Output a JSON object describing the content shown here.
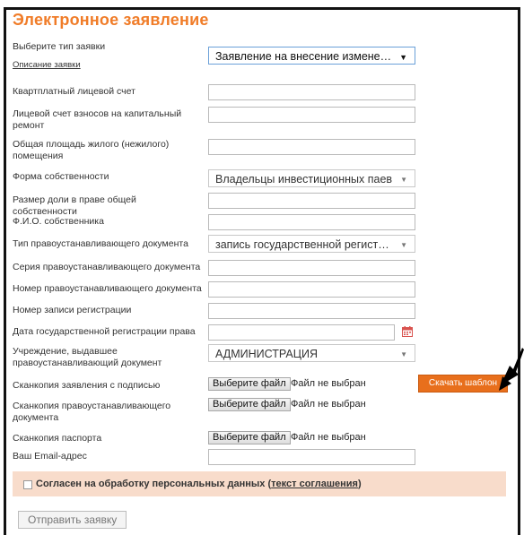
{
  "form": {
    "title": "Электронное заявление",
    "request_type_label": "Выберите тип заявки",
    "request_type_value": "Заявление на внесение изменений по",
    "description_link": "Описание заявки",
    "fields": [
      {
        "label": "Квартплатный лицевой счет",
        "value": ""
      },
      {
        "label": "Лицевой счет взносов на капитальный ремонт",
        "value": ""
      },
      {
        "label": "Общая площадь жилого (нежилого) помещения",
        "value": ""
      },
      {
        "label": "Форма собственности",
        "value": "Владельцы инвестиционных паев"
      },
      {
        "label": "Размер доли в праве общей собственности",
        "value": ""
      },
      {
        "label": "Ф.И.О. собственника",
        "value": ""
      },
      {
        "label": "Тип правоустанавливающего документа",
        "value": "запись государственной регистрац..."
      },
      {
        "label": "Серия правоустанавливающего документа",
        "value": ""
      },
      {
        "label": "Номер правоустанавливающего документа",
        "value": ""
      },
      {
        "label": "Номер записи регистрации",
        "value": ""
      },
      {
        "label": "Дата государственной регистрации права",
        "value": ""
      },
      {
        "label": "Учреждение, выдавшее правоустанавливающий документ",
        "value": "АДМИНИСТРАЦИЯ"
      },
      {
        "label": "Сканкопия заявления с подписью",
        "value": ""
      },
      {
        "label": "Сканкопия правоустанавливающего документа",
        "value": ""
      },
      {
        "label": "Сканкопия паспорта",
        "value": ""
      },
      {
        "label": "Ваш Email-адрес",
        "value": ""
      }
    ],
    "file_button_label": "Выберите файл",
    "file_status": "Файл не выбран",
    "download_template_label": "Скачать шаблон",
    "consent_prefix": "Согласен на обработку персональных данных (",
    "consent_link": "текст соглашения",
    "consent_suffix": ")",
    "submit_label": "Отправить заявку"
  },
  "colors": {
    "accent": "#f07c28",
    "download_button": "#e86f1c",
    "consent_background": "#f8dccb"
  },
  "icons": {
    "calendar": "calendar-icon",
    "select_arrow": "chevron-down-icon",
    "annotation": "arrow-pointer-icon"
  }
}
